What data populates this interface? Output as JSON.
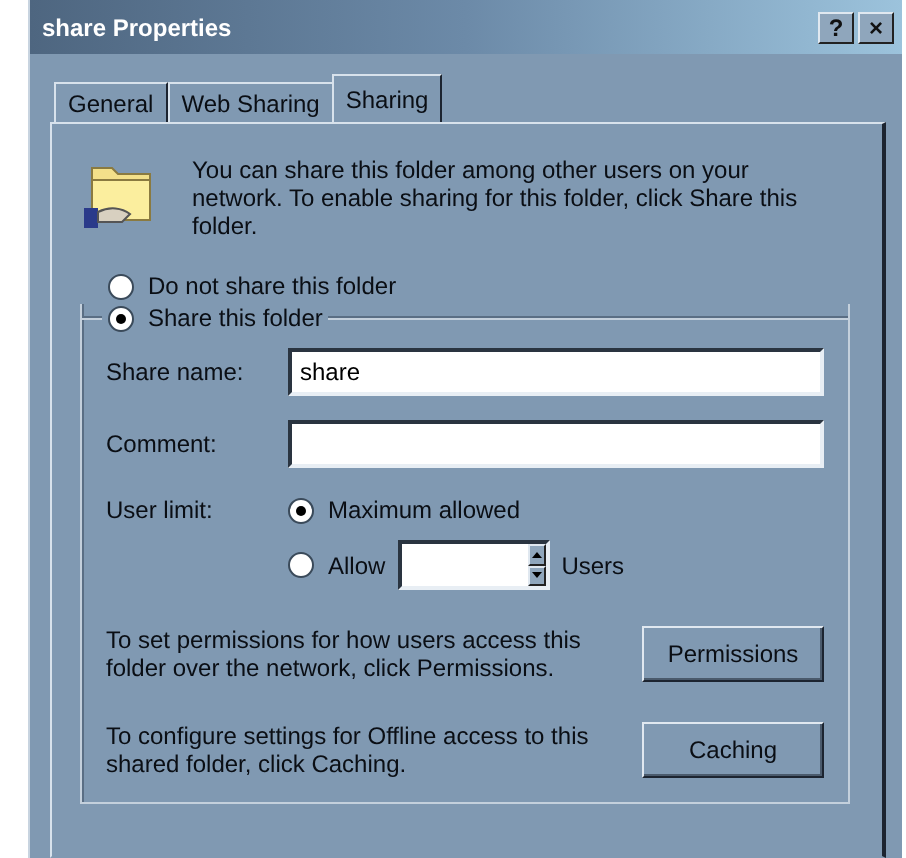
{
  "window": {
    "title": "share Properties",
    "help_button": "?",
    "close_button": "×"
  },
  "tabs": [
    {
      "label": "General",
      "selected": false
    },
    {
      "label": "Web Sharing",
      "selected": false
    },
    {
      "label": "Sharing",
      "selected": true
    }
  ],
  "intro": "You can share this folder among other users on your network.  To enable sharing for this folder, click Share this folder.",
  "share_options": [
    {
      "label": "Do not share this folder",
      "selected": false
    },
    {
      "label": "Share this folder",
      "selected": true
    }
  ],
  "share_name": {
    "label": "Share name:",
    "value": "share"
  },
  "comment": {
    "label": "Comment:"
  },
  "user_limit": {
    "label": "User limit:",
    "options": [
      {
        "label": "Maximum allowed",
        "selected": true
      },
      {
        "label": "Allow",
        "selected": false
      }
    ],
    "units": "Users"
  },
  "actions": [
    {
      "text": "To set permissions for how users access this folder over the network, click Permissions.",
      "button": "Permissions"
    },
    {
      "text": "To configure settings for Offline access to this shared folder, click Caching.",
      "button": "Caching"
    }
  ]
}
